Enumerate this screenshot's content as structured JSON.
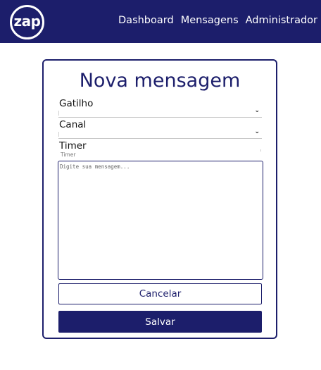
{
  "brand": {
    "logo_text": "zap"
  },
  "nav": {
    "items": [
      {
        "label": "Dashboard"
      },
      {
        "label": "Mensagens"
      },
      {
        "label": "Administrador"
      }
    ]
  },
  "form": {
    "title": "Nova mensagem",
    "gatilho": {
      "label": "Gatilho",
      "value": ""
    },
    "canal": {
      "label": "Canal",
      "value": ""
    },
    "timer": {
      "label": "Timer",
      "placeholder": "Timer"
    },
    "message": {
      "placeholder": "Digite sua mensagem..."
    },
    "cancel_label": "Cancelar",
    "save_label": "Salvar"
  },
  "colors": {
    "primary": "#1c1e6b",
    "background": "#ffffff"
  },
  "icons": {
    "select_chevron": "chevron-down-icon"
  }
}
